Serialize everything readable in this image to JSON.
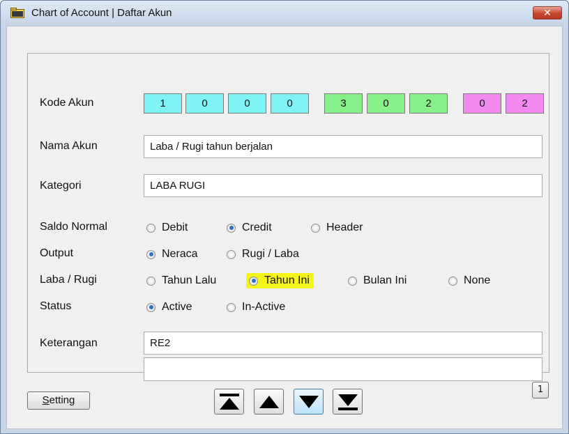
{
  "window": {
    "title": "Chart of Account | Daftar Akun",
    "close_label": "✕"
  },
  "form": {
    "kode_akun": {
      "label": "Kode Akun",
      "digits": [
        {
          "value": "1",
          "color": "#7ff3f3"
        },
        {
          "value": "0",
          "color": "#7ff3f3"
        },
        {
          "value": "0",
          "color": "#7ff3f3"
        },
        {
          "value": "0",
          "color": "#7ff3f3"
        },
        {
          "value": "3",
          "color": "#88f088"
        },
        {
          "value": "0",
          "color": "#88f088"
        },
        {
          "value": "2",
          "color": "#88f088"
        },
        {
          "value": "0",
          "color": "#f28af2"
        },
        {
          "value": "2",
          "color": "#f28af2"
        }
      ]
    },
    "nama_akun": {
      "label": "Nama Akun",
      "value": "Laba / Rugi tahun berjalan"
    },
    "kategori": {
      "label": "Kategori",
      "value": "LABA RUGI"
    },
    "saldo_normal": {
      "label": "Saldo Normal",
      "options": [
        "Debit",
        "Credit",
        "Header"
      ],
      "selected": "Credit"
    },
    "output": {
      "label": "Output",
      "options": [
        "Neraca",
        "Rugi / Laba"
      ],
      "selected": "Neraca"
    },
    "laba_rugi": {
      "label": "Laba / Rugi",
      "options": [
        "Tahun Lalu",
        "Tahun Ini",
        "Bulan Ini",
        "None"
      ],
      "selected": "Tahun Ini",
      "highlight_color": "#f5f51a"
    },
    "status": {
      "label": "Status",
      "options": [
        "Active",
        "In-Active"
      ],
      "selected": "Active"
    },
    "keterangan": {
      "label": "Keterangan",
      "line1": "RE2",
      "line2": ""
    }
  },
  "footer": {
    "setting_label_underlined": "S",
    "setting_label_rest": "etting",
    "nav_icons": [
      "first-record-icon",
      "previous-record-icon",
      "next-record-icon",
      "last-record-icon"
    ],
    "page_number": "1"
  }
}
